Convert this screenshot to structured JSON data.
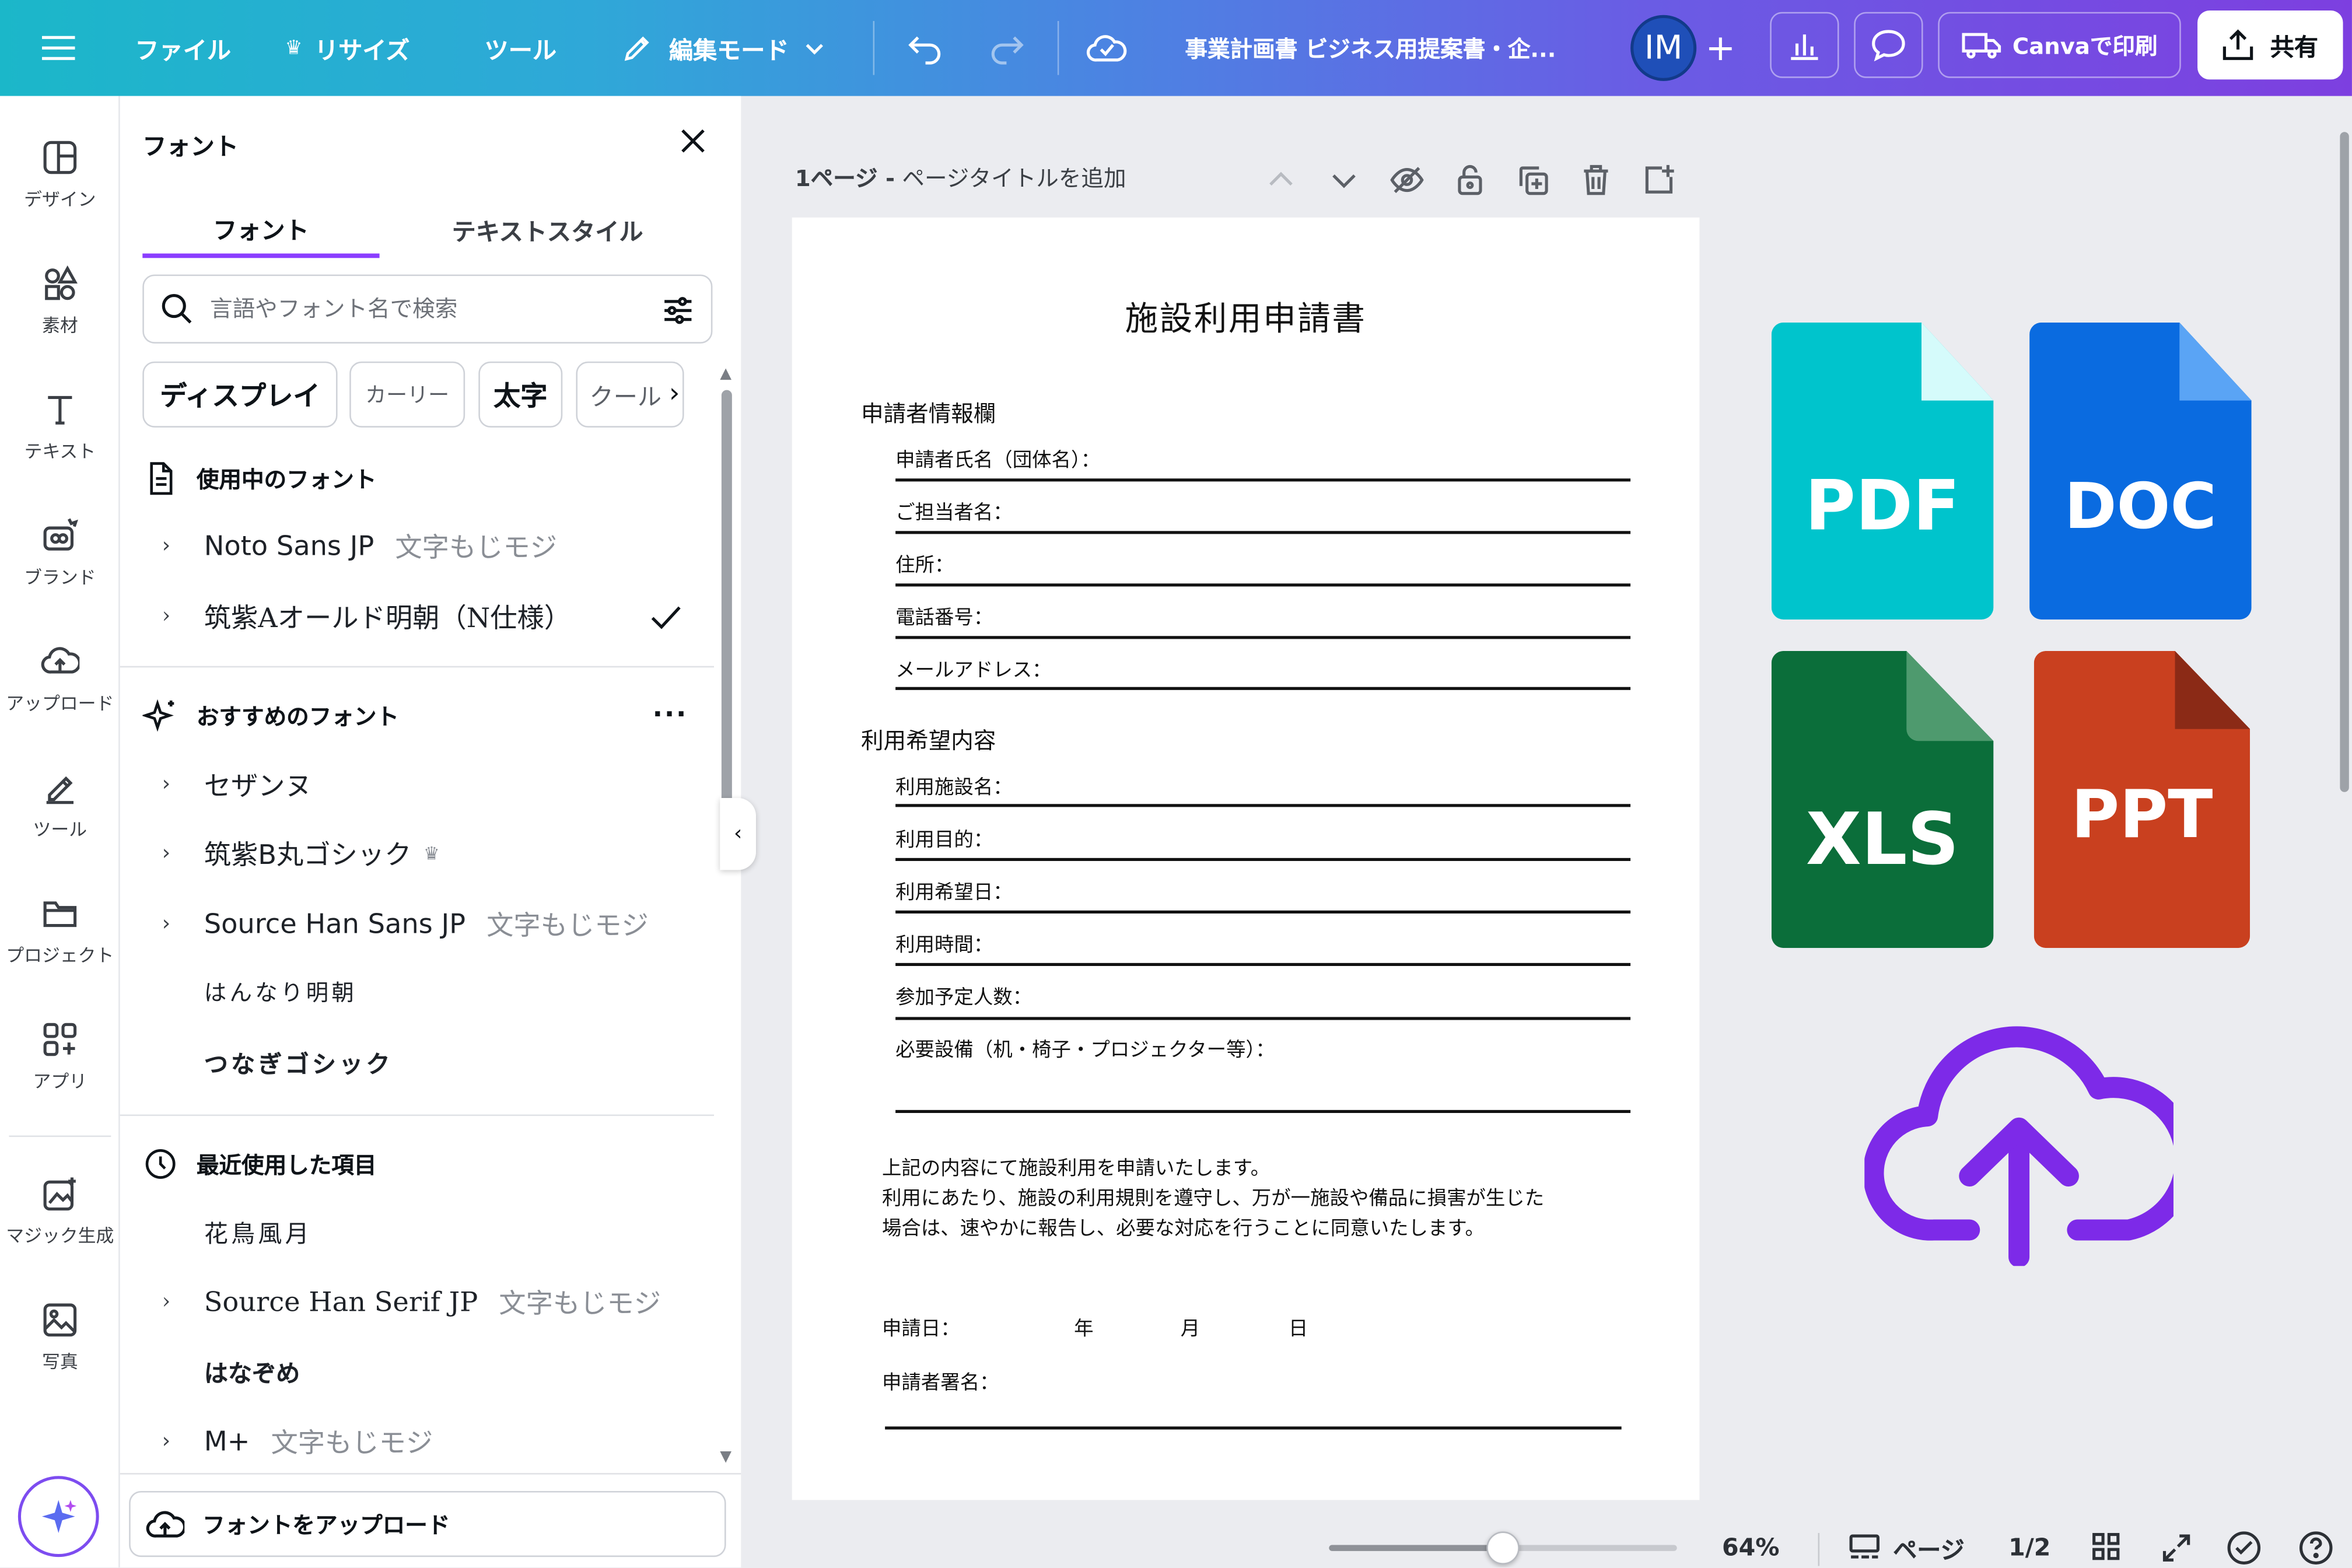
{
  "topbar": {
    "menu_icon": "hamburger-icon",
    "file": "ファイル",
    "resize": "リサイズ",
    "tools": "ツール",
    "edit_mode": "編集モード",
    "doc_title": "事業計画書 ビジネス用提案書・企...",
    "avatar_initials": "IM",
    "print": "Canvaで印刷",
    "share": "共有"
  },
  "rail": [
    {
      "label": "デザイン",
      "icon": "design-icon"
    },
    {
      "label": "素材",
      "icon": "elements-icon"
    },
    {
      "label": "テキスト",
      "icon": "text-icon"
    },
    {
      "label": "ブランド",
      "icon": "brand-icon"
    },
    {
      "label": "アップロード",
      "icon": "upload-icon"
    },
    {
      "label": "ツール",
      "icon": "tools-icon"
    },
    {
      "label": "プロジェクト",
      "icon": "folder-icon"
    },
    {
      "label": "アプリ",
      "icon": "apps-icon"
    },
    {
      "label": "マジック生成",
      "icon": "magic-media-icon"
    },
    {
      "label": "写真",
      "icon": "photo-icon"
    }
  ],
  "panel": {
    "title": "フォント",
    "tabs": [
      "フォント",
      "テキストスタイル"
    ],
    "search_placeholder": "言語やフォント名で検索",
    "chips": [
      "ディスプレイ",
      "カーリー",
      "太字",
      "クール"
    ],
    "in_use_heading": "使用中のフォント",
    "in_use": [
      {
        "name": "Noto Sans JP",
        "sample": "文字もじモジ"
      },
      {
        "name": "筑紫Aオールド明朝（N仕様）",
        "sample": ""
      }
    ],
    "recommended_heading": "おすすめのフォント",
    "recommended": [
      {
        "name": "セザンヌ",
        "sample": ""
      },
      {
        "name": "筑紫B丸ゴシック",
        "sample": ""
      },
      {
        "name": "Source Han Sans JP",
        "sample": "文字もじモジ"
      },
      {
        "name": "はんなり明朝",
        "sample": ""
      },
      {
        "name": "つなぎゴシック",
        "sample": ""
      }
    ],
    "recent_heading": "最近使用した項目",
    "recent": [
      {
        "name": "花鳥風月",
        "sample": ""
      },
      {
        "name": "Source Han Serif JP",
        "sample": "文字もじモジ"
      },
      {
        "name": "はなぞめ",
        "sample": ""
      },
      {
        "name": "M+",
        "sample": "文字もじモジ"
      }
    ],
    "upload_button": "フォントをアップロード"
  },
  "page_header": {
    "page_label": "1ページ -",
    "title_placeholder": "ページタイトルを追加"
  },
  "document": {
    "title": "施設利用申請書",
    "section1": "申請者情報欄",
    "applicant_fields": [
      "申請者氏名（団体名）：",
      "ご担当者名：",
      "住所：",
      "電話番号：",
      "メールアドレス："
    ],
    "section2": "利用希望内容",
    "usage_fields": [
      "利用施設名：",
      "利用目的：",
      "利用希望日：",
      "利用時間：",
      "参加予定人数：",
      "必要設備（机・椅子・プロジェクター等）："
    ],
    "paragraph_lines": [
      "上記の内容にて施設利用を申請いたします。",
      "利用にあたり、施設の利用規則を遵守し、万が一施設や備品に損害が生じた",
      "場合は、速やかに報告し、必要な対応を行うことに同意いたします。"
    ],
    "date_label": "申請日：",
    "year": "年",
    "month": "月",
    "day": "日",
    "signature_label": "申請者署名："
  },
  "file_icons": [
    {
      "label": "PDF",
      "color": "#00c4cc",
      "fold": "#d5fbfb"
    },
    {
      "label": "DOC",
      "color": "#0a6be0",
      "fold": "#5aa4f5"
    },
    {
      "label": "XLS",
      "color": "#0b6e3a",
      "fold": "#4e9a6e"
    },
    {
      "label": "PPT",
      "color": "#c9401f",
      "fold": "#8b2a16"
    }
  ],
  "upload_cloud_color": "#7d2ae8",
  "status": {
    "zoom": "64%",
    "zoom_level": 0.5,
    "pages_label": "ページ",
    "page_count": "1/2"
  }
}
